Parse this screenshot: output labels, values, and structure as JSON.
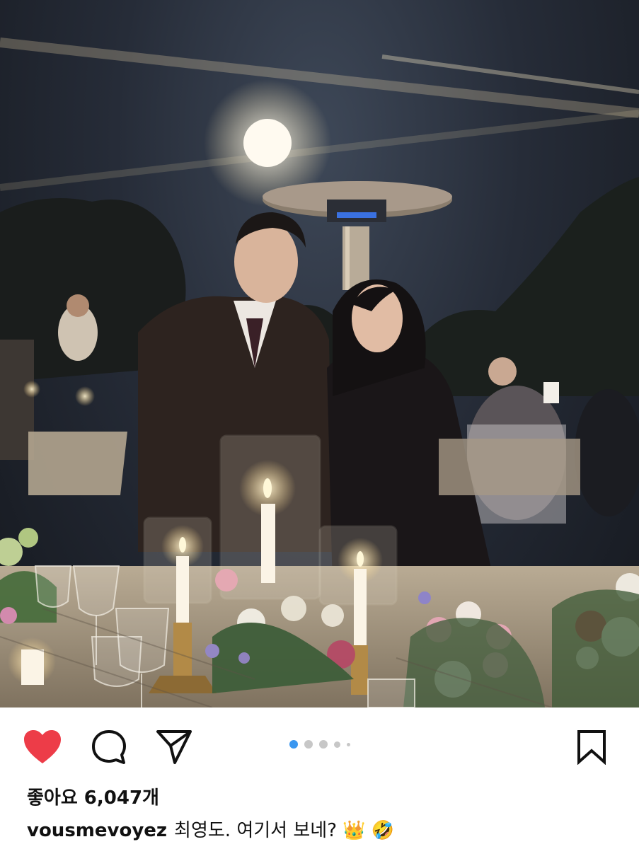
{
  "post": {
    "photo_alt": "photo",
    "icons": {
      "like": "heart-filled-icon",
      "comment": "comment-bubble-icon",
      "share": "paper-plane-icon",
      "save": "bookmark-icon"
    },
    "colors": {
      "like": "#ed3c48",
      "carousel_active": "#3a97f0",
      "carousel_inactive": "#c7c7c7"
    },
    "carousel": {
      "current": 1,
      "visible_dots": 5
    },
    "likes_text": "좋아요 6,047개",
    "caption": {
      "username": "vousmevoyez",
      "text": "최영도. 여기서 보네? 👑 🤣"
    }
  }
}
